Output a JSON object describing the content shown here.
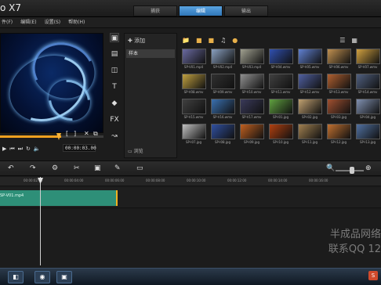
{
  "app": {
    "title": "o X7"
  },
  "steps": [
    {
      "label": "捕获"
    },
    {
      "label": "编辑"
    },
    {
      "label": "输出"
    }
  ],
  "menu": [
    {
      "label": "件(F)"
    },
    {
      "label": "编辑(E)"
    },
    {
      "label": "设置(S)"
    },
    {
      "label": "帮助(H)"
    }
  ],
  "player": {
    "timecode": "00:00:03.00",
    "trim_in": "[",
    "trim_out": "]"
  },
  "library": {
    "add_label": "添加",
    "selected_folder": "样本",
    "browse_label": "浏览",
    "categories": [
      "media-icon",
      "instant-project-icon",
      "transition-icon",
      "title-icon",
      "graphic-icon",
      "filter-icon",
      "path-icon"
    ],
    "media": [
      {
        "name": "SP-V01.mp4",
        "color": "#6a6aa0"
      },
      {
        "name": "SP-V02.mp4",
        "color": "#8aa0c0"
      },
      {
        "name": "SP-V03.mp4",
        "color": "#a0a090"
      },
      {
        "name": "SP-V04.wmv",
        "color": "#3050b0"
      },
      {
        "name": "SP-V05.wmv",
        "color": "#6080d0"
      },
      {
        "name": "SP-V06.wmv",
        "color": "#c09050"
      },
      {
        "name": "SP-V07.wmv",
        "color": "#d0a040"
      },
      {
        "name": "SP-V08.wmv",
        "color": "#c0a040"
      },
      {
        "name": "SP-V09.wmv",
        "color": "#303030"
      },
      {
        "name": "SP-V10.wmv",
        "color": "#909090"
      },
      {
        "name": "SP-V11.wmv",
        "color": "#404040"
      },
      {
        "name": "SP-V12.wmv",
        "color": "#5060a0"
      },
      {
        "name": "SP-V13.wmv",
        "color": "#b06030"
      },
      {
        "name": "SP-V14.wmv",
        "color": "#506080"
      },
      {
        "name": "SP-V15.wmv",
        "color": "#404040"
      },
      {
        "name": "SP-V16.wmv",
        "color": "#3a70b0"
      },
      {
        "name": "SP-V17.wmv",
        "color": "#3a3a5a"
      },
      {
        "name": "SP-I01.jpg",
        "color": "#60a040"
      },
      {
        "name": "SP-I02.jpg",
        "color": "#c0a070"
      },
      {
        "name": "SP-I03.jpg",
        "color": "#a05030"
      },
      {
        "name": "SP-I04.jpg",
        "color": "#8090b0"
      },
      {
        "name": "SP-I07.jpg",
        "color": "#c0c0c0"
      },
      {
        "name": "SP-I08.jpg",
        "color": "#3050a0"
      },
      {
        "name": "SP-I09.jpg",
        "color": "#c06020"
      },
      {
        "name": "SP-I10.jpg",
        "color": "#b04010"
      },
      {
        "name": "SP-I11.jpg",
        "color": "#a08050"
      },
      {
        "name": "SP-I12.jpg",
        "color": "#c07030"
      },
      {
        "name": "SP-I13.jpg",
        "color": "#5070a0"
      }
    ]
  },
  "timeline": {
    "ruler": [
      "00:00:02:00",
      "00:00:04:00",
      "00:00:06:00",
      "00:00:08:00",
      "00:00:10:00",
      "00:00:12:00",
      "00:00:14:00",
      "00:00:16:00"
    ],
    "clip_name": "SP-V01.mp4"
  },
  "watermark": {
    "line1": "半成品网络",
    "line2": "联系QQ 12"
  }
}
